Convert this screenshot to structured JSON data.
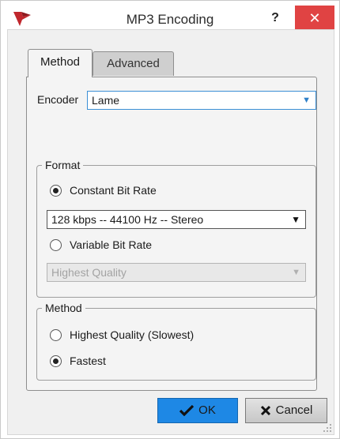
{
  "window": {
    "title": "MP3 Encoding",
    "help_label": "?",
    "close_label": "✕"
  },
  "tabs": [
    {
      "label": "Method",
      "active": true
    },
    {
      "label": "Advanced",
      "active": false
    }
  ],
  "encoder": {
    "label": "Encoder",
    "value": "Lame"
  },
  "format": {
    "legend": "Format",
    "constant_label": "Constant Bit Rate",
    "constant_checked": true,
    "constant_value": "128 kbps -- 44100 Hz -- Stereo",
    "variable_label": "Variable Bit Rate",
    "variable_checked": false,
    "variable_value": "Highest Quality"
  },
  "method": {
    "legend": "Method",
    "options": [
      {
        "label": "Highest Quality (Slowest)",
        "checked": false
      },
      {
        "label": "Fastest",
        "checked": true
      }
    ]
  },
  "buttons": {
    "ok_label": "OK",
    "cancel_label": "Cancel"
  },
  "colors": {
    "close_bg": "#e04343",
    "ok_bg": "#1e88e5",
    "accent": "#3b8fd6"
  }
}
